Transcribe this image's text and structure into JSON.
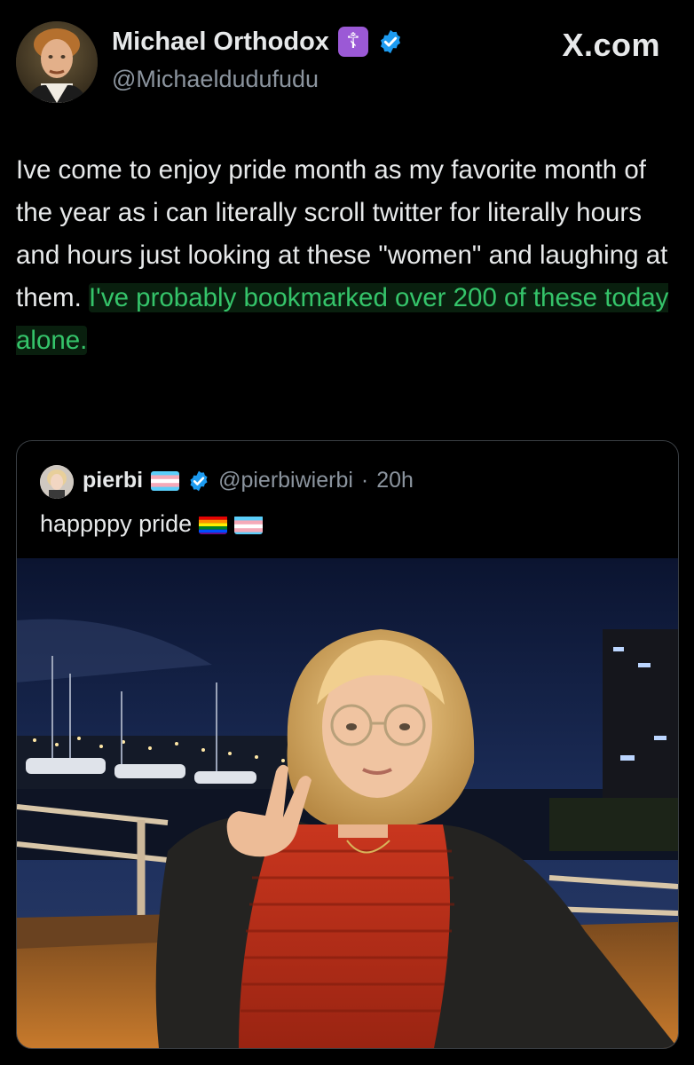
{
  "tweet": {
    "author_name": "Michael Orthodox",
    "author_handle": "@Michaeldudufudu",
    "site_logo": "X.com",
    "badge_glyph": "☦",
    "body_plain": "Ive come to enjoy pride month as my favorite month of the year as i can literally scroll twitter for literally hours and hours just looking at these \"women\" and laughing at them. ",
    "body_highlighted": "I've probably bookmarked over 200 of these today alone.",
    "highlight_color": "#35c46a"
  },
  "quote": {
    "author_name": "pierbi",
    "author_handle": "@pierbiwierbi",
    "separator": "·",
    "time": "20h",
    "text": "happppy pride",
    "photo_description_icons": [
      "flag-trans-icon",
      "flag-rainbow-icon"
    ]
  },
  "colors": {
    "background": "#000000",
    "text": "#e7e9ea",
    "secondary_text": "#8b949e",
    "verified_blue": "#1d9bf0",
    "badge_purple": "#9b59d6",
    "card_border": "#3a3f44"
  }
}
